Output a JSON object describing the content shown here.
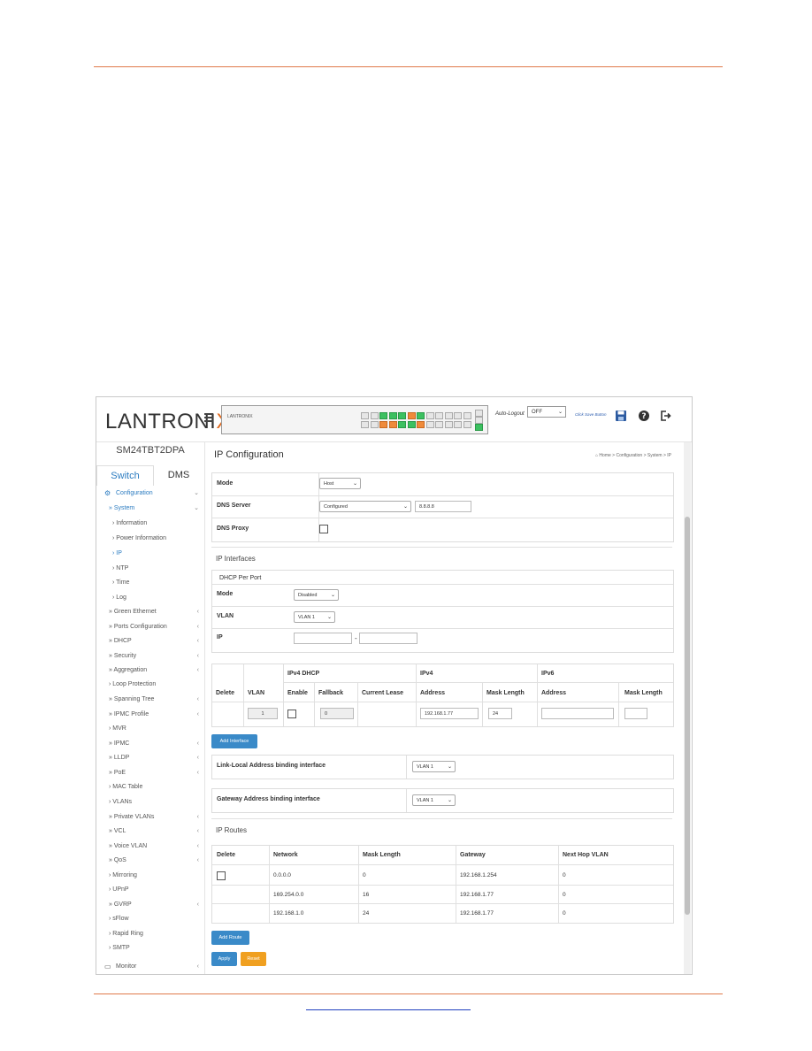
{
  "brand": {
    "logo_text": "LANTRONIX",
    "panel_label": "LANTRONIX"
  },
  "topbar": {
    "autologout_label": "Auto-Logout",
    "autologout_value": "OFF",
    "click_save_label": "Click Save Button"
  },
  "sidebar": {
    "device_name": "SM24TBT2DPA",
    "tabs": [
      "Switch",
      "DMS"
    ],
    "items": [
      {
        "label": "Configuration",
        "chev": "⌄"
      },
      {
        "label": "» System",
        "chev": "⌄"
      },
      {
        "label": "› Information",
        "chev": ""
      },
      {
        "label": "› Power Information",
        "chev": ""
      },
      {
        "label": "› IP",
        "chev": ""
      },
      {
        "label": "› NTP",
        "chev": ""
      },
      {
        "label": "› Time",
        "chev": ""
      },
      {
        "label": "› Log",
        "chev": ""
      },
      {
        "label": "» Green Ethernet",
        "chev": "‹"
      },
      {
        "label": "» Ports Configuration",
        "chev": "‹"
      },
      {
        "label": "» DHCP",
        "chev": "‹"
      },
      {
        "label": "» Security",
        "chev": "‹"
      },
      {
        "label": "» Aggregation",
        "chev": "‹"
      },
      {
        "label": "› Loop Protection",
        "chev": ""
      },
      {
        "label": "» Spanning Tree",
        "chev": "‹"
      },
      {
        "label": "» IPMC Profile",
        "chev": "‹"
      },
      {
        "label": "› MVR",
        "chev": ""
      },
      {
        "label": "» IPMC",
        "chev": "‹"
      },
      {
        "label": "» LLDP",
        "chev": "‹"
      },
      {
        "label": "» PoE",
        "chev": "‹"
      },
      {
        "label": "› MAC Table",
        "chev": ""
      },
      {
        "label": "› VLANs",
        "chev": ""
      },
      {
        "label": "» Private VLANs",
        "chev": "‹"
      },
      {
        "label": "» VCL",
        "chev": "‹"
      },
      {
        "label": "» Voice VLAN",
        "chev": "‹"
      },
      {
        "label": "» QoS",
        "chev": "‹"
      },
      {
        "label": "› Mirroring",
        "chev": ""
      },
      {
        "label": "› UPnP",
        "chev": ""
      },
      {
        "label": "» GVRP",
        "chev": "‹"
      },
      {
        "label": "› sFlow",
        "chev": ""
      },
      {
        "label": "› Rapid Ring",
        "chev": ""
      },
      {
        "label": "› SMTP",
        "chev": ""
      },
      {
        "label": "Monitor",
        "chev": "‹"
      }
    ]
  },
  "page": {
    "title": "IP Configuration",
    "breadcrumb": "Home > Configuration > System > IP",
    "mode_label": "Mode",
    "mode_value": "Host",
    "dns_server_label": "DNS Server",
    "dns_server_mode": "Configured",
    "dns_server_value": "8.8.8.8",
    "dns_proxy_label": "DNS Proxy"
  },
  "ip_interfaces": {
    "section": "IP Interfaces",
    "dhcp_per_port": "DHCP Per Port",
    "mode_label": "Mode",
    "mode_value": "Disabled",
    "vlan_label": "VLAN",
    "vlan_value": "VLAN 1",
    "ip_label": "IP",
    "ip_sep": "-",
    "table": {
      "group_ipv4_dhcp": "IPv4 DHCP",
      "group_ipv4": "IPv4",
      "group_ipv6": "IPv6",
      "headers": [
        "Delete",
        "VLAN",
        "Enable",
        "Fallback",
        "Current Lease",
        "Address",
        "Mask Length",
        "Address",
        "Mask Length"
      ],
      "row": {
        "vlan": "1",
        "fallback": "0",
        "ipv4_address": "192.168.1.77",
        "ipv4_mask": "24",
        "ipv6_address": "",
        "ipv6_mask": ""
      }
    },
    "add_interface": "Add Interface"
  },
  "link_local": {
    "label": "Link-Local Address binding interface",
    "value": "VLAN 1"
  },
  "gateway_binding": {
    "label": "Gateway Address binding interface",
    "value": "VLAN 1"
  },
  "ip_routes": {
    "section": "IP Routes",
    "headers": [
      "Delete",
      "Network",
      "Mask Length",
      "Gateway",
      "Next Hop VLAN"
    ],
    "rows": [
      {
        "network": "0.0.0.0",
        "mask": "0",
        "gateway": "192.168.1.254",
        "vlan": "0"
      },
      {
        "network": "169.254.0.0",
        "mask": "16",
        "gateway": "192.168.1.77",
        "vlan": "0"
      },
      {
        "network": "192.168.1.0",
        "mask": "24",
        "gateway": "192.168.1.77",
        "vlan": "0"
      }
    ],
    "add_route": "Add Route"
  },
  "buttons": {
    "apply": "Apply",
    "reset": "Reset"
  }
}
